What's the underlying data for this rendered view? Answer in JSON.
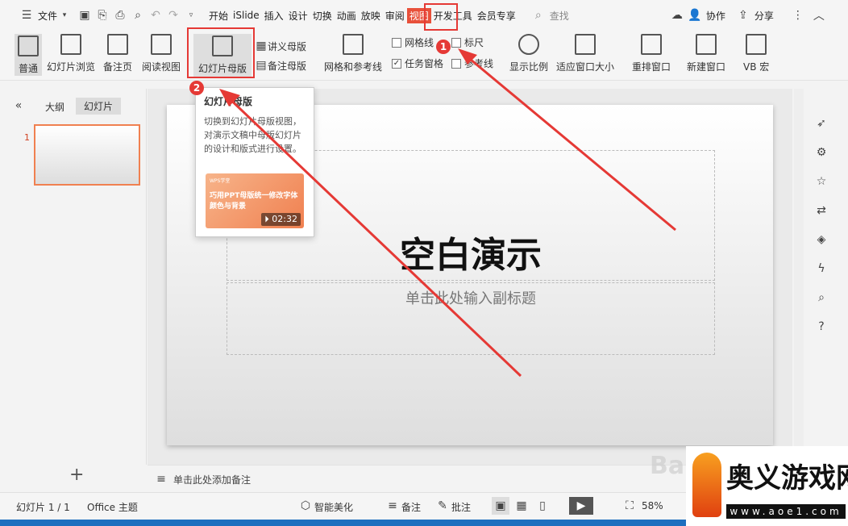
{
  "menubar": {
    "file": "文件",
    "tabs": [
      "开始",
      "iSlide",
      "插入",
      "设计",
      "切换",
      "动画",
      "放映",
      "审阅",
      "视图",
      "开发工具",
      "会员专享"
    ],
    "search": "查找",
    "collab": "协作",
    "share": "分享"
  },
  "ribbon": {
    "normal": "普通",
    "sorter": "幻灯片浏览",
    "notes_page": "备注页",
    "reading": "阅读视图",
    "slide_master": "幻灯片母版",
    "handout_master": "讲义母版",
    "notes_master": "备注母版",
    "grid": "网格和参考线",
    "gridlines": "网格线",
    "ruler": "标尺",
    "task_pane": "任务窗格",
    "guides": "参考线",
    "zoom": "显示比例",
    "fit": "适应窗口大小",
    "arrange": "重排窗口",
    "new_window": "新建窗口",
    "vb": "VB 宏"
  },
  "left_panel": {
    "outline_tab": "大纲",
    "slides_tab": "幻灯片",
    "slide_number": "1",
    "add": "+"
  },
  "slide": {
    "title": "空白演示",
    "subtitle": "单击此处输入副标题"
  },
  "notes": {
    "placeholder": "单击此处添加备注"
  },
  "tooltip": {
    "title": "幻灯片母版",
    "body": "切换到幻灯片母版视图，对演示文稿中母版幻灯片的设计和版式进行设置。",
    "video_tag": "WPS学堂",
    "video_title": "巧用PPT母版统一修改字体颜色与背景",
    "duration": "02:32"
  },
  "status": {
    "slide_count": "幻灯片 1 / 1",
    "theme": "Office 主题",
    "beautify": "智能美化",
    "notes": "备注",
    "comments": "批注",
    "zoom": "58%"
  },
  "annotations": {
    "badge1": "1",
    "badge2": "2"
  },
  "watermark": {
    "site": "奥义游戏网",
    "url": "www.aoe1.com",
    "bai": "Ba"
  },
  "colors": {
    "accent": "#e53935",
    "highlight_tab": "#e8503a",
    "selection": "#f08050"
  }
}
